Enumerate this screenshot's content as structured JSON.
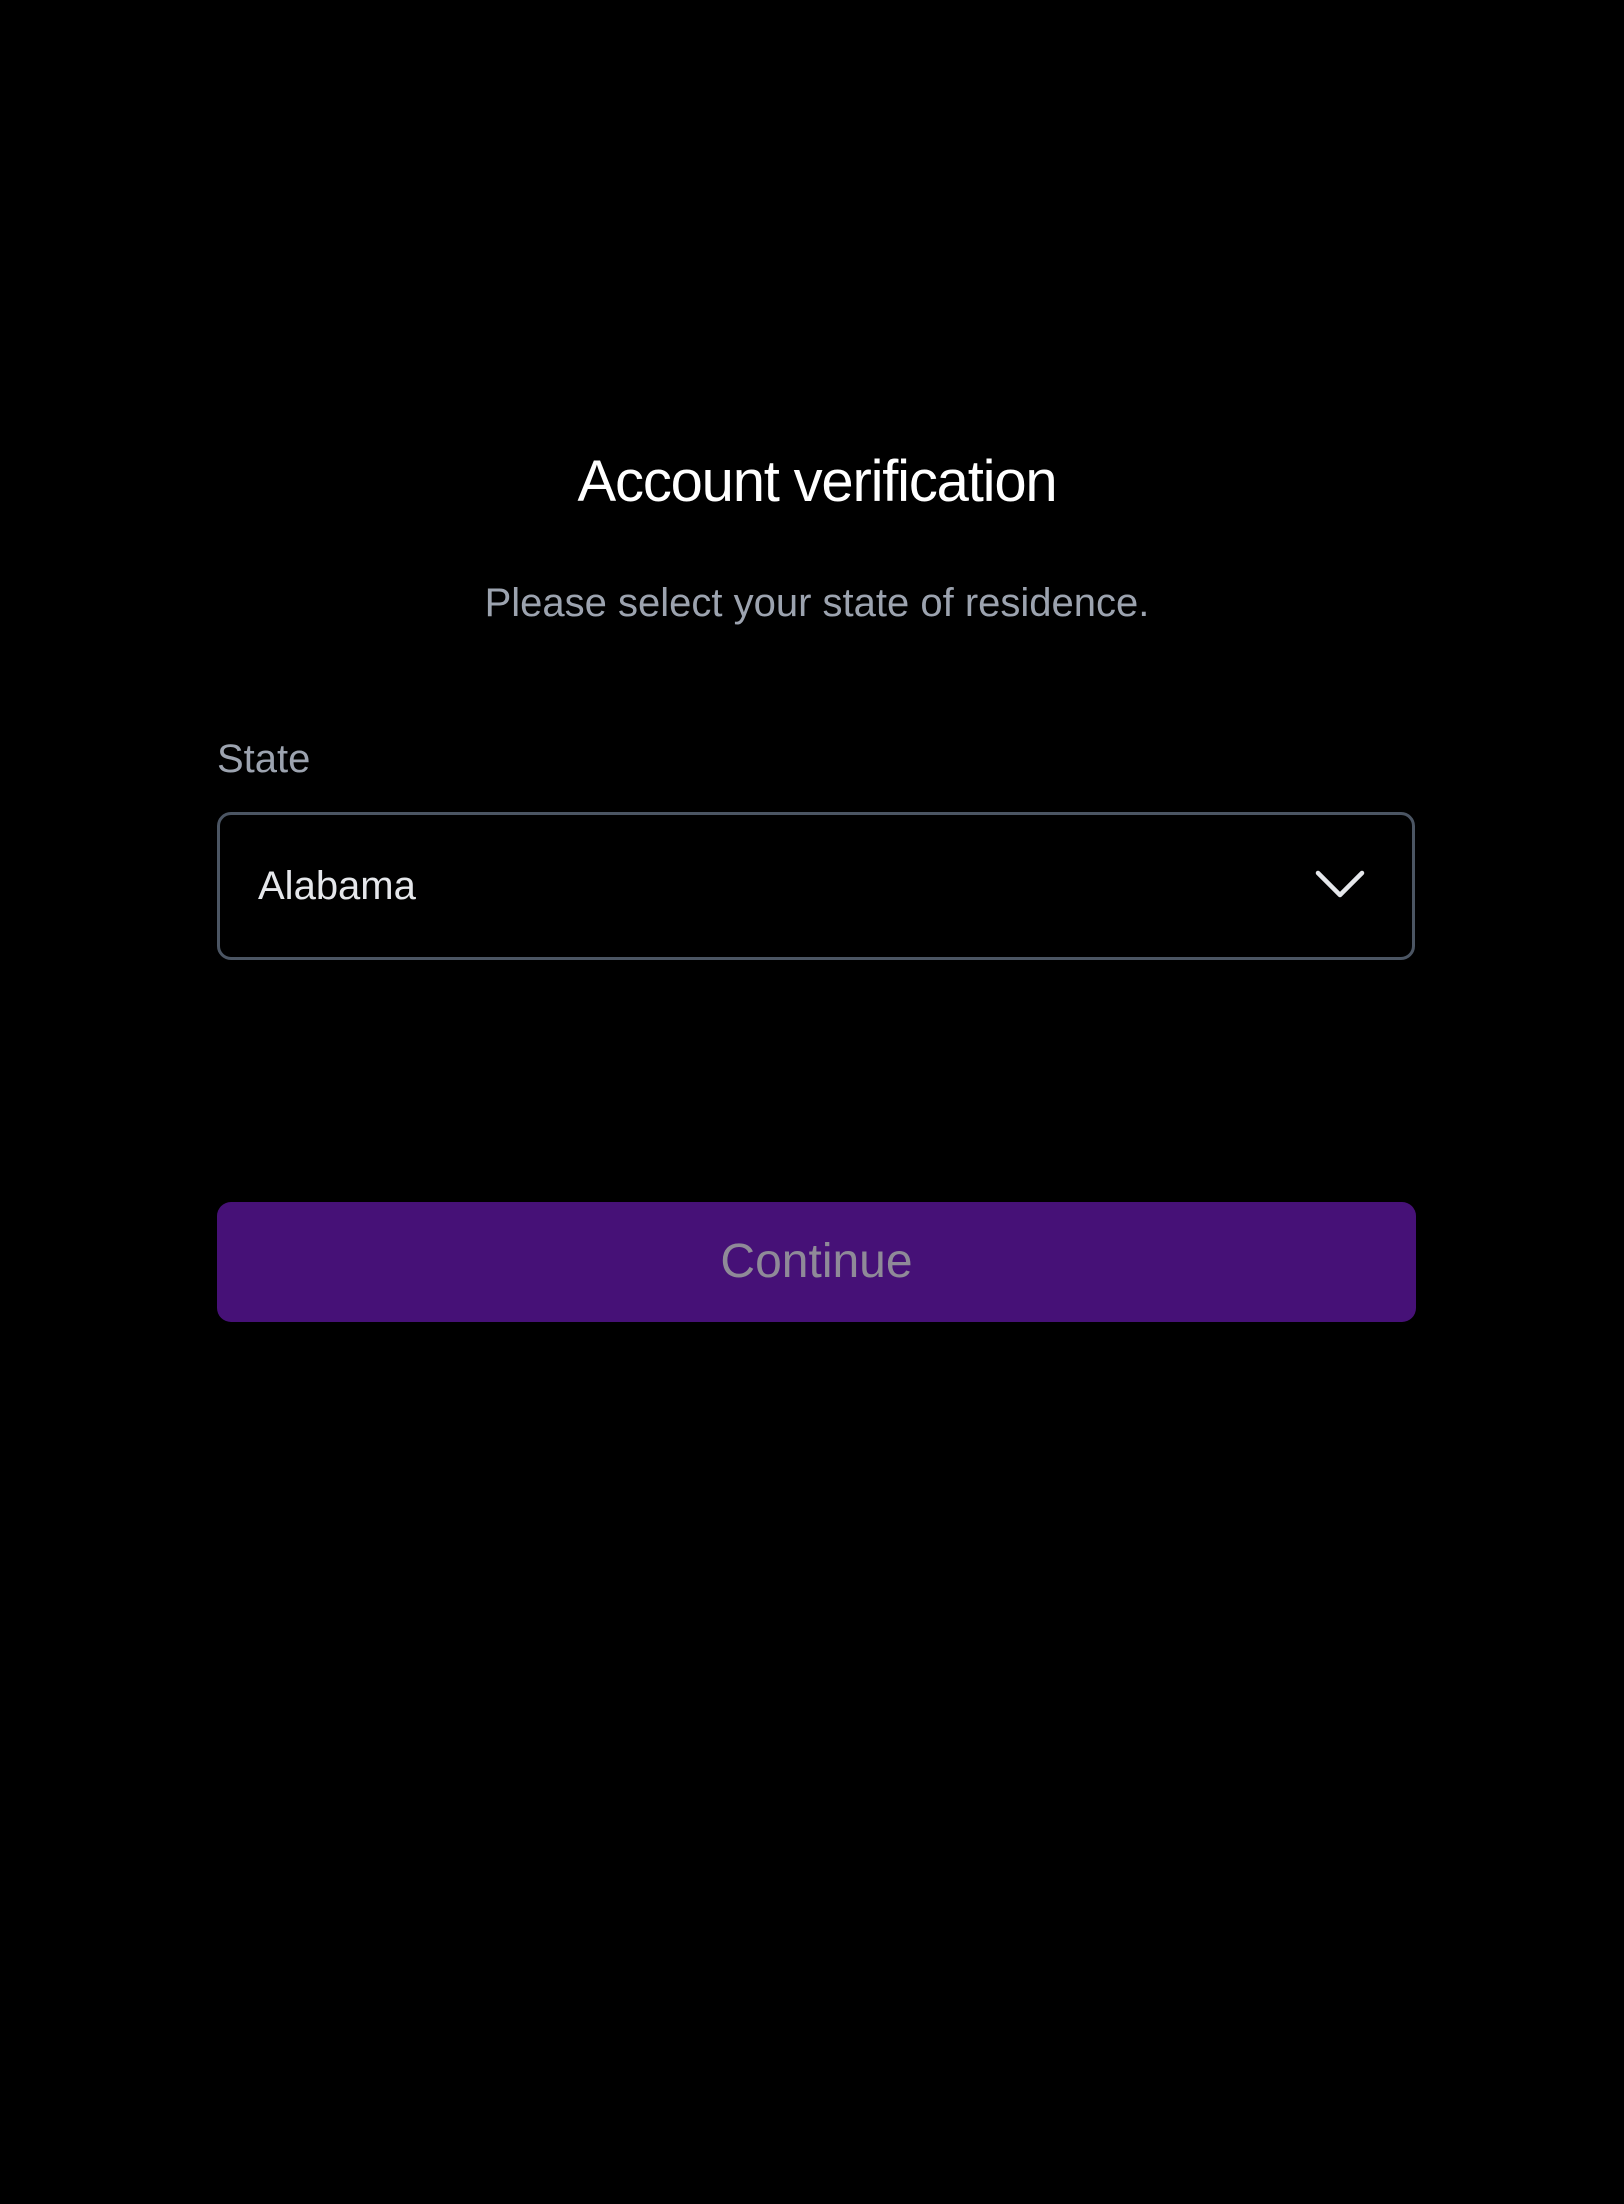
{
  "header": {
    "title": "Account verification",
    "subtitle": "Please select your state of residence."
  },
  "form": {
    "state_label": "State",
    "state_value": "Alabama",
    "state_icon": "chevron-down-icon",
    "continue_label": "Continue"
  },
  "colors": {
    "background": "#000000",
    "title": "#ffffff",
    "muted_text": "#9ca3af",
    "select_border": "#4b5563",
    "button_bg": "#461177",
    "button_text": "#8f8a98"
  }
}
